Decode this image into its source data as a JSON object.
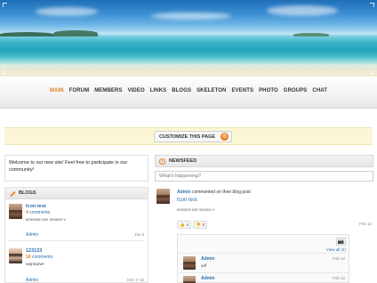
{
  "nav": {
    "items": [
      "MAIN",
      "FORUM",
      "MEMBERS",
      "VIDEO",
      "LINKS",
      "BLOGS",
      "SKELETON",
      "EVENTS",
      "PHOTO",
      "GROUPS",
      "CHAT"
    ],
    "active": "MAIN",
    "active_color": "#e0801c"
  },
  "customize": {
    "label": "CUSTOMIZE THIS PAGE",
    "icon": "gear-icon"
  },
  "welcome": {
    "text": "Welcome to our new site! Feel free to participate in our community!"
  },
  "blogs": {
    "title": "BLOGS",
    "entries": [
      {
        "title": "Icon test",
        "comments_count": "4",
        "comments_label": "comments",
        "excerpt": "vcvxcvx vxc vcxvcx v",
        "author": "Admin",
        "date": "Jan 8"
      },
      {
        "title": "123123",
        "comments_count": "10",
        "comments_label": "comments",
        "excerpt": "wqrwqrwr",
        "author": "Admin",
        "date": "Dec 3 '15"
      }
    ]
  },
  "newsfeed": {
    "title": "NEWSFEED",
    "placeholder": "What's happening?",
    "post": {
      "author": "Admin",
      "action": "commented on their blog post",
      "title": "Icon test",
      "excerpt": "vcvxcvx vxc vcxvcx v",
      "date": "Feb 12",
      "likes": "4",
      "dislikes": "0",
      "view_all": "View all (4)",
      "comments": [
        {
          "author": "Admin",
          "text": "sdf",
          "date": "Feb 12"
        },
        {
          "author": "Admin",
          "text": "",
          "date": "Feb 12"
        }
      ]
    }
  }
}
